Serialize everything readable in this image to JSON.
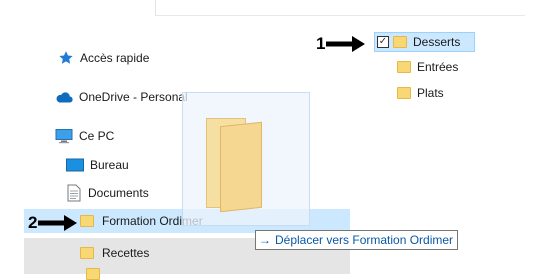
{
  "nav": {
    "quick_access": "Accès rapide",
    "onedrive": "OneDrive - Personal",
    "this_pc": "Ce PC",
    "desktop": "Bureau",
    "documents": "Documents",
    "folder_training": "Formation Ordimer",
    "folder_recipes": "Recettes"
  },
  "content": {
    "folders": [
      {
        "label": "Desserts",
        "selected": true,
        "checked": true
      },
      {
        "label": "Entrées",
        "selected": false
      },
      {
        "label": "Plats",
        "selected": false
      }
    ]
  },
  "drag_tooltip": {
    "arrow": "→",
    "text": "Déplacer vers Formation Ordimer"
  },
  "callouts": [
    {
      "number": "1"
    },
    {
      "number": "2"
    }
  ],
  "colors": {
    "selection": "#cce8ff",
    "hover_row": "#e5e5e5",
    "folder": "#f8d775",
    "tooltip_text": "#0a57a4",
    "quick_access_star": "#1f7bd6"
  },
  "icons": {
    "quick_access": "star-icon",
    "onedrive": "cloud-icon",
    "this_pc": "computer-icon",
    "desktop": "desktop-icon",
    "documents": "document-icon",
    "folders": "folder-icon",
    "callout": "arrow-right-icon"
  }
}
